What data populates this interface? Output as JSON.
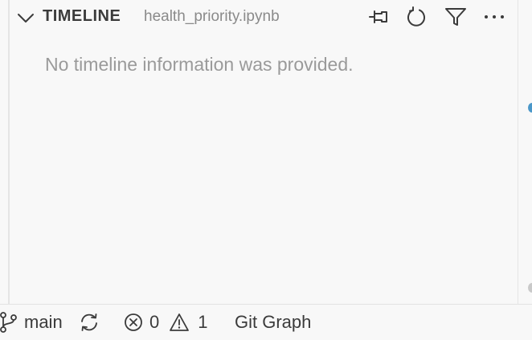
{
  "panel": {
    "title": "TIMELINE",
    "subtitle": "health_priority.ipynb",
    "empty_message": "No timeline information was provided.",
    "actions": [
      {
        "name": "pin",
        "icon": "pin-icon"
      },
      {
        "name": "refresh",
        "icon": "refresh-icon"
      },
      {
        "name": "filter",
        "icon": "filter-icon"
      },
      {
        "name": "more",
        "icon": "more-icon"
      }
    ]
  },
  "statusbar": {
    "branch": "main",
    "errors": "0",
    "warnings": "1",
    "git_graph": "Git Graph"
  },
  "colors": {
    "background": "#f8f8f8",
    "text": "#3b3b3b",
    "muted": "#9a9a9a",
    "accent": "#4a97c9"
  }
}
